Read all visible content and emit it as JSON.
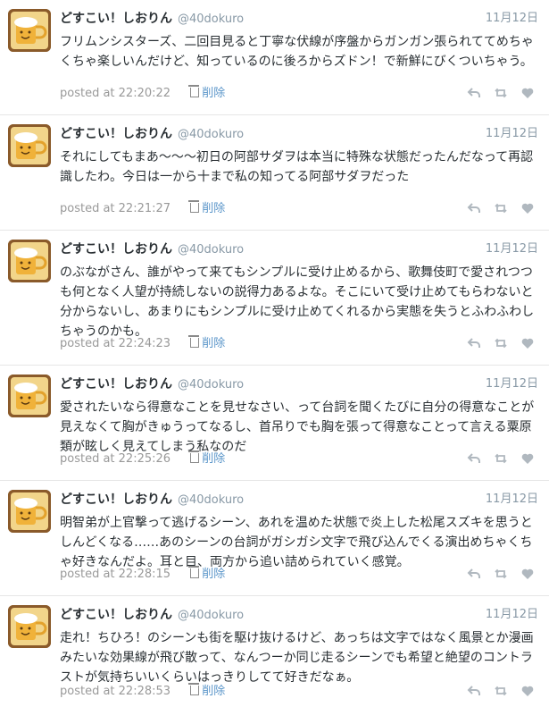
{
  "tweets": [
    {
      "name": "どすこい！しおりん",
      "handle": "@40dokuro",
      "date": "11月12日",
      "text": "フリムンシスターズ、二回目見ると丁寧な伏線が序盤からガンガン張られててめちゃくちゃ楽しいんだけど、知っているのに後ろからズドン！で新鮮にびくついちゃう。",
      "posted": "posted at 22:20:22",
      "delete": "削除"
    },
    {
      "name": "どすこい！しおりん",
      "handle": "@40dokuro",
      "date": "11月12日",
      "text": "それにしてもまあ〜〜〜初日の阿部サダヲは本当に特殊な状態だったんだなって再認識したわ。今日は一から十まで私の知ってる阿部サダヲだった",
      "posted": "posted at 22:21:27",
      "delete": "削除"
    },
    {
      "name": "どすこい！しおりん",
      "handle": "@40dokuro",
      "date": "11月12日",
      "text": "のぶながさん、誰がやって来てもシンプルに受け止めるから、歌舞伎町で愛されつつも何となく人望が持続しないの説得力あるよな。そこにいて受け止めてもらわないと分からないし、あまりにもシンプルに受け止めてくれるから実態を失うとふわふわしちゃうのかも。",
      "posted": "posted at 22:24:23",
      "delete": "削除"
    },
    {
      "name": "どすこい！しおりん",
      "handle": "@40dokuro",
      "date": "11月12日",
      "text": "愛されたいなら得意なことを見せなさい、って台詞を聞くたびに自分の得意なことが見えなくて胸がきゅうってなるし、首吊りでも胸を張って得意なことって言える粟原類が眩しく見えてしまう私なのだ",
      "posted": "posted at 22:25:26",
      "delete": "削除"
    },
    {
      "name": "どすこい！しおりん",
      "handle": "@40dokuro",
      "date": "11月12日",
      "text": "明智弟が上官撃って逃げるシーン、あれを温めた状態で炎上した松尾スズキを思うとしんどくなる……あのシーンの台詞がガシガシ文字で飛び込んでくる演出めちゃくちゃ好きなんだよ。耳と目、両方から追い詰められていく感覚。",
      "posted": "posted at 22:28:15",
      "delete": "削除"
    },
    {
      "name": "どすこい！しおりん",
      "handle": "@40dokuro",
      "date": "11月12日",
      "text": "走れ！ちひろ！のシーンも街を駆け抜けるけど、あっちは文字ではなく風景とか漫画みたいな効果線が飛び散って、なんつーか同じ走るシーンでも希望と絶望のコントラストが気持ちいいくらいはっきりしてて好きだなぁ。",
      "posted": "posted at 22:28:53",
      "delete": "削除"
    }
  ],
  "icons": {
    "reply": "reply-icon",
    "retweet": "retweet-icon",
    "favorite": "heart-icon",
    "delete": "trash-icon"
  },
  "colors": {
    "name": "#292f33",
    "muted": "#8899a6",
    "link": "#5a95c9",
    "icon": "#b0b8bf"
  }
}
